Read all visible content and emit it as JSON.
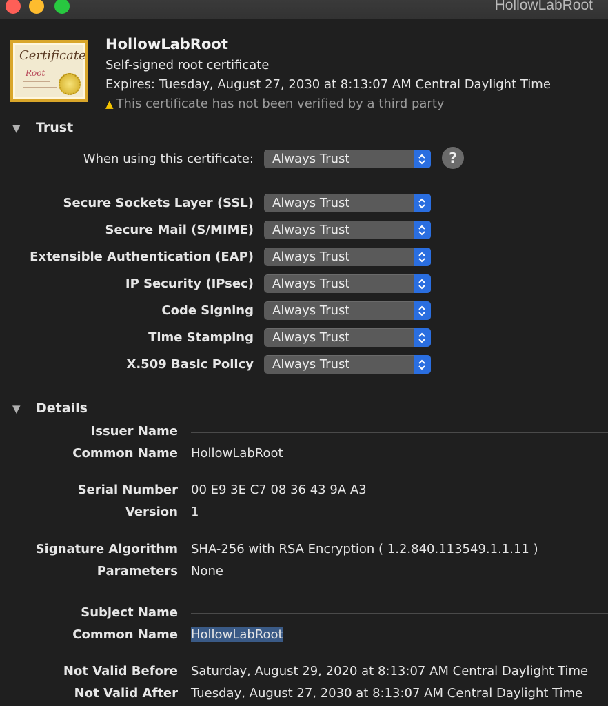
{
  "window": {
    "title": "HollowLabRoot"
  },
  "header": {
    "name": "HollowLabRoot",
    "kind": "Self-signed root certificate",
    "expires": "Expires: Tuesday, August 27, 2030 at 8:13:07 AM Central Daylight Time",
    "warning": "This certificate has not been verified by a third party",
    "icon_text_1": "Certificate",
    "icon_text_2": "Root"
  },
  "trust": {
    "heading": "Trust",
    "when_using_label": "When using this certificate:",
    "when_using_value": "Always Trust",
    "help": "?",
    "policies": [
      {
        "label": "Secure Sockets Layer (SSL)",
        "value": "Always Trust"
      },
      {
        "label": "Secure Mail (S/MIME)",
        "value": "Always Trust"
      },
      {
        "label": "Extensible Authentication (EAP)",
        "value": "Always Trust"
      },
      {
        "label": "IP Security (IPsec)",
        "value": "Always Trust"
      },
      {
        "label": "Code Signing",
        "value": "Always Trust"
      },
      {
        "label": "Time Stamping",
        "value": "Always Trust"
      },
      {
        "label": "X.509 Basic Policy",
        "value": "Always Trust"
      }
    ]
  },
  "details": {
    "heading": "Details",
    "issuer_name": "Issuer Name",
    "issuer_common_name_label": "Common Name",
    "issuer_common_name": "HollowLabRoot",
    "serial_number_label": "Serial Number",
    "serial_number": "00 E9 3E C7 08 36 43 9A A3",
    "version_label": "Version",
    "version": "1",
    "signature_algorithm_label": "Signature Algorithm",
    "signature_algorithm": "SHA-256 with RSA Encryption ( 1.2.840.113549.1.1.11 )",
    "parameters_label": "Parameters",
    "parameters": "None",
    "subject_name": "Subject Name",
    "subject_common_name_label": "Common Name",
    "subject_common_name": "HollowLabRoot",
    "not_valid_before_label": "Not Valid Before",
    "not_valid_before": "Saturday, August 29, 2020 at 8:13:07 AM Central Daylight Time",
    "not_valid_after_label": "Not Valid After",
    "not_valid_after": "Tuesday, August 27, 2030 at 8:13:07 AM Central Daylight Time"
  },
  "colors": {
    "background": "#1f1f1f",
    "select_accent": "#2a6ee0",
    "warning_icon": "#f5c400",
    "selection_highlight": "#3a5a86"
  }
}
